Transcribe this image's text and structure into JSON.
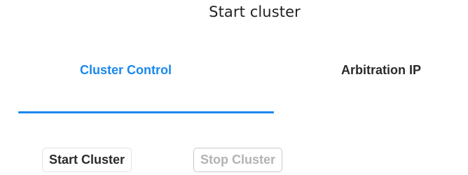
{
  "dialog": {
    "title": "Start cluster"
  },
  "tabs": [
    {
      "label": "Cluster Control",
      "active": true
    },
    {
      "label": "Arbitration IP",
      "active": false
    }
  ],
  "actions": {
    "start_label": "Start Cluster",
    "stop_label": "Stop Cluster",
    "stop_disabled": true
  },
  "colors": {
    "accent": "#1b88ee",
    "text": "#2a2a2a",
    "disabled_text": "#b3b3b3"
  }
}
